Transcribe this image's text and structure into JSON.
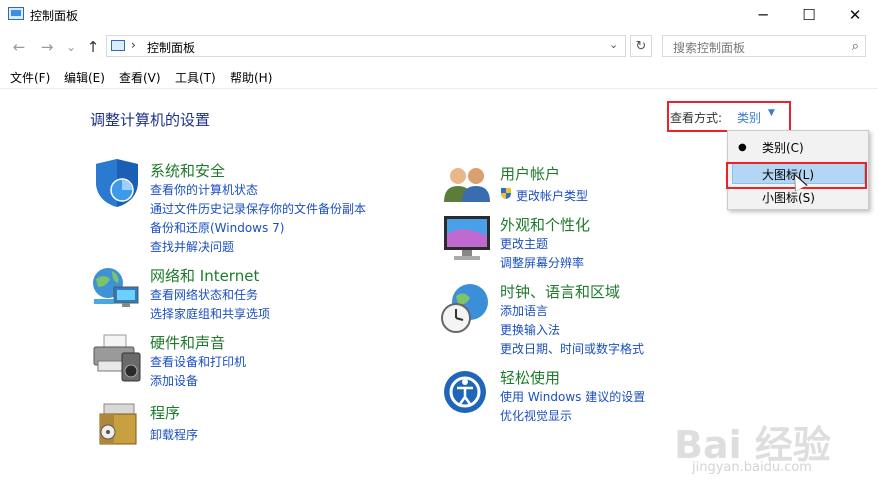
{
  "window": {
    "title": "控制面板",
    "minimize": "─",
    "maximize": "☐",
    "close": "✕"
  },
  "address": {
    "back": "←",
    "forward": "→",
    "dropdown": "⌄",
    "up": "↑",
    "separator": "›",
    "path": "控制面板",
    "refresh": "↻",
    "search_placeholder": "搜索控制面板",
    "search_icon": "⌕"
  },
  "menu": [
    "文件(F)",
    "编辑(E)",
    "查看(V)",
    "工具(T)",
    "帮助(H)"
  ],
  "main": {
    "heading": "调整计算机的设置",
    "view_by_label": "查看方式:",
    "view_by_value": "类别",
    "view_by_arrow": "▼"
  },
  "dropdown": {
    "items": [
      "类别(C)",
      "大图标(L)",
      "小图标(S)"
    ],
    "selected": "类别(C)",
    "bullet": "●",
    "highlighted": "大图标(L)"
  },
  "categories": {
    "left": [
      {
        "title": "系统和安全",
        "links": [
          "查看你的计算机状态",
          "通过文件历史记录保存你的文件备份副本",
          "备份和还原(Windows 7)",
          "查找并解决问题"
        ]
      },
      {
        "title": "网络和 Internet",
        "links": [
          "查看网络状态和任务",
          "选择家庭组和共享选项"
        ]
      },
      {
        "title": "硬件和声音",
        "links": [
          "查看设备和打印机",
          "添加设备"
        ]
      },
      {
        "title": "程序",
        "links": [
          "卸载程序"
        ]
      }
    ],
    "right": [
      {
        "title": "用户帐户",
        "links": [
          "更改帐户类型"
        ]
      },
      {
        "title": "外观和个性化",
        "links": [
          "更改主题",
          "调整屏幕分辨率"
        ]
      },
      {
        "title": "时钟、语言和区域",
        "links": [
          "添加语言",
          "更换输入法",
          "更改日期、时间或数字格式"
        ]
      },
      {
        "title": "轻松使用",
        "links": [
          "使用 Windows 建议的设置",
          "优化视觉显示"
        ]
      }
    ]
  },
  "watermark": {
    "text": "Bai 经验",
    "url": "jingyan.baidu.com"
  },
  "colors": {
    "heading": "#1e3287",
    "category_title": "#1f7a2c",
    "link": "#1a4fbf",
    "highlight_box": "#e8232a"
  }
}
